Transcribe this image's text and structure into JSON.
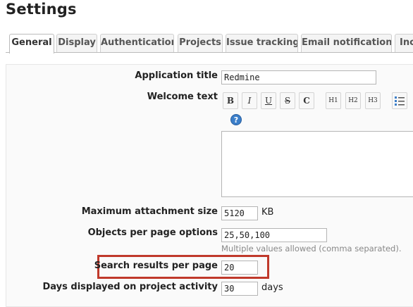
{
  "page": {
    "title": "Settings"
  },
  "tabs": [
    {
      "label": "General",
      "selected": true
    },
    {
      "label": "Display",
      "selected": false
    },
    {
      "label": "Authentication",
      "selected": false
    },
    {
      "label": "Projects",
      "selected": false
    },
    {
      "label": "Issue tracking",
      "selected": false
    },
    {
      "label": "Email notifications",
      "selected": false
    },
    {
      "label": "Inc",
      "selected": false
    }
  ],
  "form": {
    "app_title": {
      "label": "Application title",
      "value": "Redmine"
    },
    "welcome_text": {
      "label": "Welcome text",
      "value": ""
    },
    "toolbar": {
      "buttons": [
        "B",
        "I",
        "U",
        "S",
        "C",
        "H1",
        "H2",
        "H3"
      ],
      "icons": [
        "bold-icon",
        "italic-icon",
        "underline-icon",
        "strikethrough-icon",
        "code-icon",
        "heading1-icon",
        "heading2-icon",
        "heading3-icon",
        "unordered-list-icon",
        "help-icon"
      ]
    },
    "max_attachment": {
      "label": "Maximum attachment size",
      "value": "5120",
      "unit": "KB"
    },
    "per_page_options": {
      "label": "Objects per page options",
      "value": "25,50,100",
      "hint": "Multiple values allowed (comma separated)."
    },
    "search_results": {
      "label": "Search results per page",
      "value": "20"
    },
    "activity_days": {
      "label": "Days displayed on project activity",
      "value": "30",
      "unit": "days"
    }
  },
  "colors": {
    "highlight": "#c0392b",
    "tab_border": "#cfcfcf",
    "help_icon": "#3b7ec9"
  }
}
